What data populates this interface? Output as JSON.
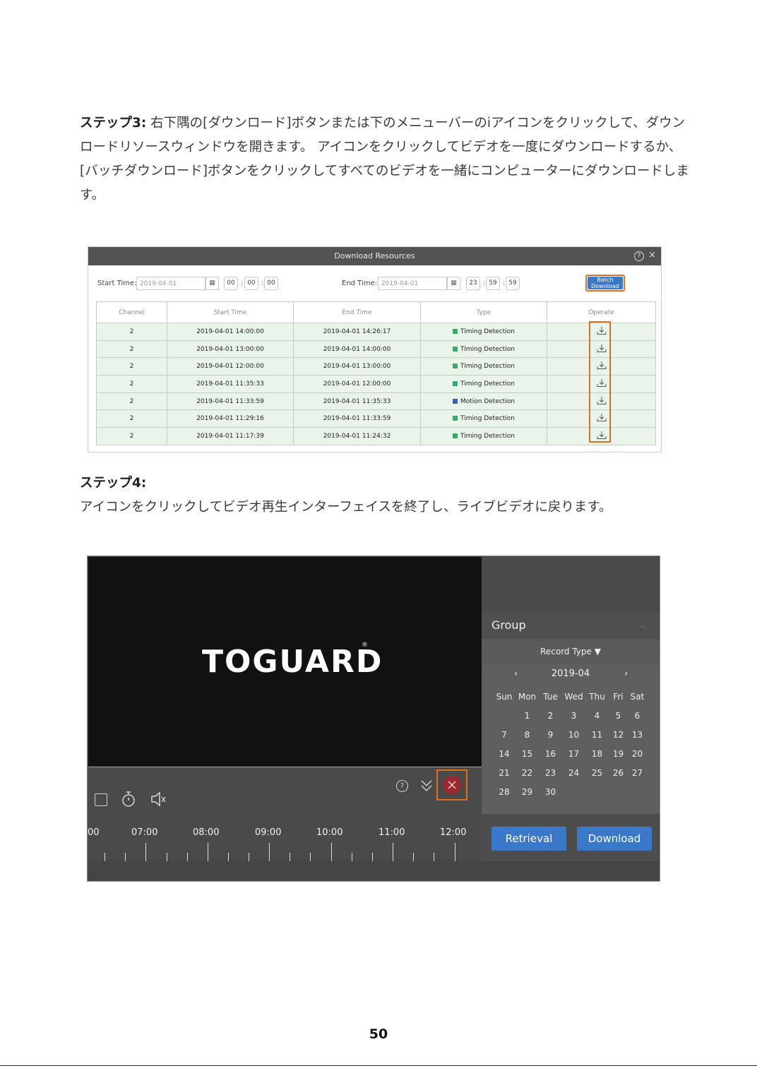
{
  "step3": {
    "label": "ステップ3:",
    "text": "右下隅の[ダウンロード]ボタンまたは下のメニューバーのiアイコンをクリックして、ダウンロードリソースウィンドウを開きます。 アイコンをクリックしてビデオを一度にダウンロードするか、[バッチダウンロード]ボタンをクリックしてすべてのビデオを一緒にコンピューターにダウンロードします。"
  },
  "download_window": {
    "title": "Download Resources",
    "help_icon": "help-circle-icon",
    "close_icon": "close-icon",
    "start_label": "Start Time:",
    "start_date": "2019-04-01",
    "start_h": "00",
    "start_m": "00",
    "start_s": "00",
    "end_label": "End Time:",
    "end_date": "2019-04-01",
    "end_h": "23",
    "end_m": "59",
    "end_s": "59",
    "batch_line1": "Batch",
    "batch_line2": "Download",
    "columns": [
      "Channel",
      "Start Time",
      "End Time",
      "Type",
      "Operate"
    ],
    "rows": [
      {
        "channel": "2",
        "start": "2019-04-01  14:00:00",
        "end": "2019-04-01  14:26:17",
        "type": "Timing Detection",
        "color": "#2eae6a"
      },
      {
        "channel": "2",
        "start": "2019-04-01  13:00:00",
        "end": "2019-04-01  14:00:00",
        "type": "Timing Detection",
        "color": "#2eae6a"
      },
      {
        "channel": "2",
        "start": "2019-04-01  12:00:00",
        "end": "2019-04-01  13:00:00",
        "type": "Timing Detection",
        "color": "#2eae6a"
      },
      {
        "channel": "2",
        "start": "2019-04-01  11:35:33",
        "end": "2019-04-01  12:00:00",
        "type": "Timing Detection",
        "color": "#2eae6a"
      },
      {
        "channel": "2",
        "start": "2019-04-01  11:33:59",
        "end": "2019-04-01  11:35:33",
        "type": "Motion Detection",
        "color": "#2f62c4"
      },
      {
        "channel": "2",
        "start": "2019-04-01  11:29:16",
        "end": "2019-04-01  11:33:59",
        "type": "Timing Detection",
        "color": "#2eae6a"
      },
      {
        "channel": "2",
        "start": "2019-04-01  11:17:39",
        "end": "2019-04-01  11:24:32",
        "type": "Timing Detection",
        "color": "#2eae6a"
      }
    ],
    "highlight_color": "#e07020"
  },
  "step4": {
    "label": "ステップ4:",
    "text": "アイコンをクリックしてビデオ再生インターフェイスを終了し、ライブビデオに戻ります。"
  },
  "playback": {
    "logo": "TOGUARD",
    "logo_mark": "®",
    "group": "Group",
    "record_type": "Record Type ▼",
    "month": "2019-04",
    "weekdays": [
      "Sun",
      "Mon",
      "Tue",
      "Wed",
      "Thu",
      "Fri",
      "Sat"
    ],
    "weeks": [
      [
        "",
        "1",
        "2",
        "3",
        "4",
        "5",
        "6"
      ],
      [
        "7",
        "8",
        "9",
        "10",
        "11",
        "12",
        "13"
      ],
      [
        "14",
        "15",
        "16",
        "17",
        "18",
        "19",
        "20"
      ],
      [
        "21",
        "22",
        "23",
        "24",
        "25",
        "26",
        "27"
      ],
      [
        "28",
        "29",
        "30",
        "",
        "",
        "",
        ""
      ]
    ],
    "retrieval": "Retrieval",
    "download": "Download",
    "timeline": [
      "00",
      "07:00",
      "08:00",
      "09:00",
      "10:00",
      "11:00",
      "12:00"
    ]
  },
  "page_number": "50"
}
